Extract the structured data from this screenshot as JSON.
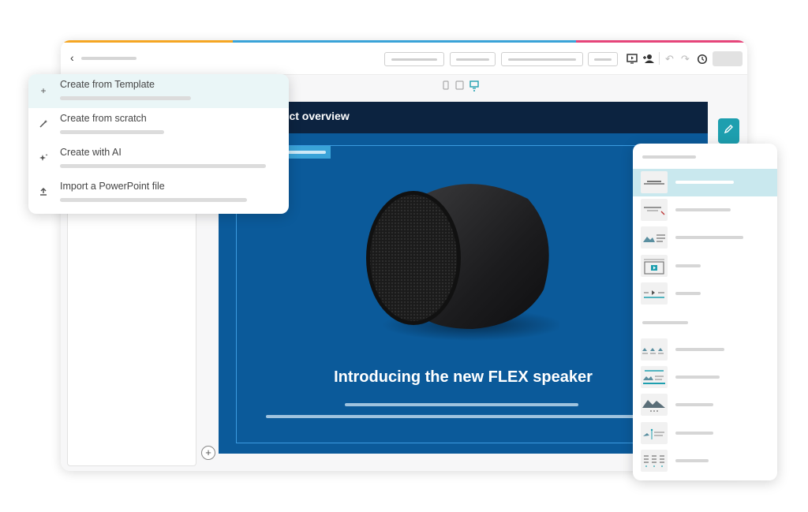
{
  "colors": {
    "stripe": [
      "#f5a623",
      "#3aa3d8",
      "#3aa3d8",
      "#e6457a"
    ],
    "accent": "#1e9faf",
    "slide_bg": "#0b5a9a",
    "slide_header": "#0c2340"
  },
  "toolbar": {
    "back_icon": "chevron-left-icon",
    "device_icons": [
      "phone-icon",
      "tablet-icon",
      "desktop-icon"
    ],
    "icons": [
      "present-icon",
      "share-user-icon",
      "undo-icon",
      "redo-icon",
      "history-icon"
    ]
  },
  "create_menu": {
    "items": [
      {
        "label": "Create from Template",
        "icon": "plus-icon"
      },
      {
        "label": "Create from scratch",
        "icon": "magic-wand-icon"
      },
      {
        "label": "Create with AI",
        "icon": "sparkle-icon"
      },
      {
        "label": "Import a PowerPoint file",
        "icon": "upload-icon"
      }
    ]
  },
  "slide": {
    "title": "luct overview",
    "headline": "Introducing the new FLEX speaker"
  },
  "layouts_panel": {
    "icons": [
      "layout-title-icon",
      "layout-subtitle-icon",
      "layout-image-text-icon",
      "layout-video-icon",
      "layout-media-icon",
      "layout-gallery-icon",
      "layout-caption-icon",
      "layout-landscape-icon",
      "layout-diagram-icon",
      "layout-columns-icon"
    ]
  },
  "edit_button_icon": "pencil-icon",
  "add_slide_icon": "plus-icon"
}
